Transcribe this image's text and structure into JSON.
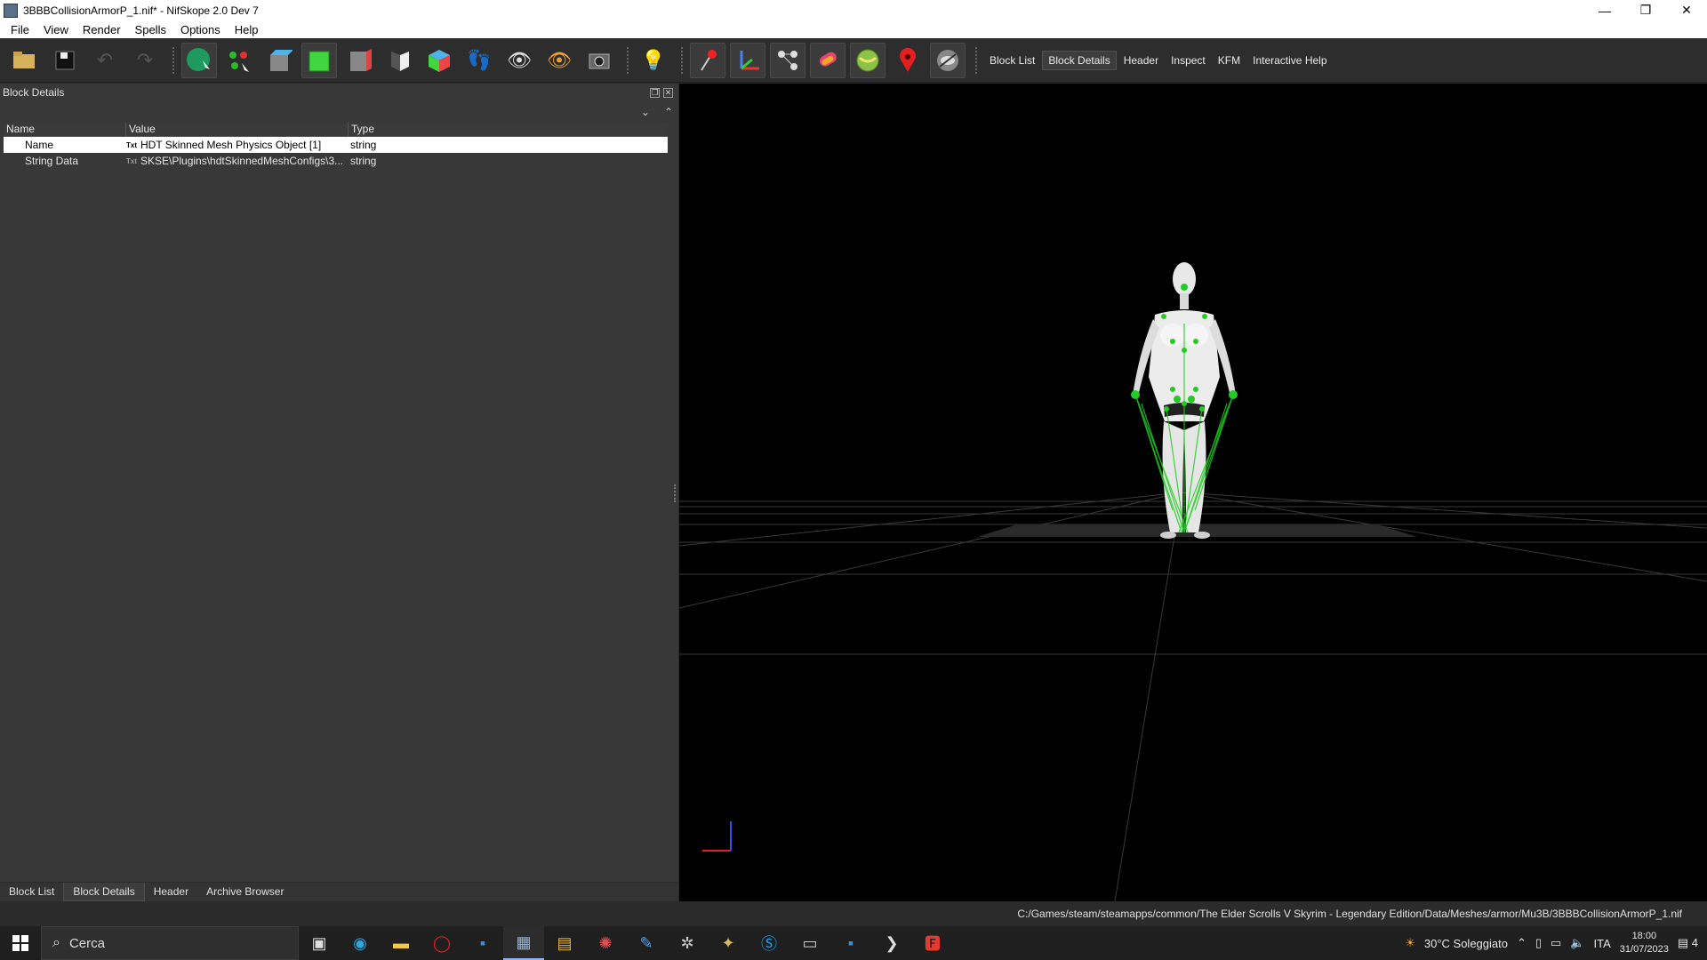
{
  "window": {
    "title": "3BBBCollisionArmorP_1.nif* - NifSkope 2.0 Dev 7",
    "minimize": "—",
    "maximize": "❐",
    "close": "✕"
  },
  "menu": [
    "File",
    "View",
    "Render",
    "Spells",
    "Options",
    "Help"
  ],
  "toolbar_links": [
    "Block List",
    "Block Details",
    "Header",
    "Inspect",
    "KFM",
    "Interactive Help"
  ],
  "toolbar_active": "Block Details",
  "panel": {
    "title": "Block Details",
    "columns": [
      "Name",
      "Value",
      "Type"
    ],
    "rows": [
      {
        "name": "Name",
        "value": "HDT Skinned Mesh Physics Object [1]",
        "type": "string",
        "icon": "Txt"
      },
      {
        "name": "String Data",
        "value": "SKSE\\Plugins\\hdtSkinnedMeshConfigs\\3...",
        "type": "string",
        "icon": "Txt"
      }
    ],
    "tabs": [
      "Block List",
      "Block Details",
      "Header",
      "Archive Browser"
    ]
  },
  "status": {
    "path": "C:/Games/steam/steamapps/common/The Elder Scrolls V Skyrim - Legendary Edition/Data/Meshes/armor/Mu3B/3BBBCollisionArmorP_1.nif"
  },
  "taskbar": {
    "search_placeholder": "Cerca",
    "weather": "30°C  Soleggiato",
    "lang": "ITA",
    "time": "18:00",
    "date": "31/07/2023",
    "notifications": "4"
  },
  "colors": {
    "accent_green": "#22cc22",
    "selection": "#ffffff",
    "viewport_bg": "#000000"
  }
}
